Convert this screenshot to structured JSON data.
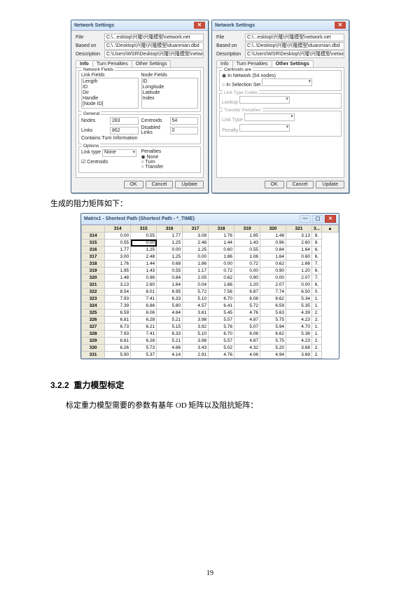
{
  "page_number": "19",
  "dlg1": {
    "title": "Network Settings",
    "kv": [
      {
        "lbl": "File",
        "val": "C:\\...esktop\\兴隆\\兴隆模型\\network.net"
      },
      {
        "lbl": "Based on",
        "val": "C:\\..\\Desktop\\兴隆\\兴隆模型\\duanmian.dbd"
      },
      {
        "lbl": "Description",
        "val": "C:\\Users\\WSR\\Desktop\\兴隆\\兴隆模型\\network.net"
      }
    ],
    "tabs": {
      "t1": "Info",
      "t2": "Turn Penalties",
      "t3": "Other Settings"
    },
    "legend_fields": "Network Fields",
    "link_hdr": "Link Fields",
    "node_hdr": "Node Fields",
    "link_items": [
      "Length",
      "ID",
      "Dir",
      "Handle",
      "[Node ID]"
    ],
    "node_items": [
      "ID",
      "Longitude",
      "Latitude",
      "Index"
    ],
    "legend_general": "General",
    "gen": {
      "nodes_l": "Nodes",
      "nodes_v": "283",
      "cent_l": "Centroids",
      "cent_v": "54",
      "links_l": "Links",
      "links_v": "862",
      "dis_l": "Disabled Links",
      "dis_v": "0",
      "cti": "Contains Turn Information"
    },
    "legend_options": "Options",
    "opt": {
      "lt": "Link type",
      "lt_v": "None",
      "pen": "Penalties",
      "p1": "None",
      "p2": "Turn",
      "p3": "Transfer",
      "cent": "Centroids"
    },
    "btn": {
      "ok": "OK",
      "cancel": "Cancel",
      "update": "Update"
    }
  },
  "dlg2": {
    "title": "Network Settings",
    "kv": [
      {
        "lbl": "File",
        "val": "C:\\...esktop\\兴隆\\兴隆模型\\network.net"
      },
      {
        "lbl": "Based on",
        "val": "C:\\..\\Desktop\\兴隆\\兴隆模型\\duanmian.dbd"
      },
      {
        "lbl": "Description",
        "val": "C:\\Users\\WSR\\Desktop\\兴隆\\兴隆模型\\network.net"
      }
    ],
    "tabs": {
      "t1": "Info",
      "t2": "Turn Penalties",
      "t3": "Other Settings"
    },
    "legend_centroids": "Centroids are",
    "cent": {
      "r1": "In Network (54 nodes)",
      "r2": "In Selection Set"
    },
    "legend_ltc": "Link Type Codes",
    "ltc_l": "Lookup",
    "legend_tp": "Transfer Penalties",
    "tp_l1": "Link Type",
    "tp_l2": "Penalty",
    "btn": {
      "ok": "OK",
      "cancel": "Cancel",
      "update": "Update"
    }
  },
  "text_after_screens": "生成的阻力矩阵如下：",
  "section_number": "3.2.2",
  "section_title": "重力模型标定",
  "paragraph": "标定重力模型需要的参数有基年 OD 矩阵以及阻抗矩阵：",
  "matrix_title": "Matrix1 - Shortest Path (Shortest Path - *_TIME)",
  "chart_data": {
    "type": "table",
    "title": "Matrix1 - Shortest Path (Shortest Path - *_TIME)",
    "col_headers": [
      "314",
      "315",
      "316",
      "317",
      "318",
      "319",
      "320",
      "321",
      "3..."
    ],
    "tail_col": "▲",
    "rows": [
      {
        "h": "314",
        "v": [
          "0.00",
          "0.55",
          "1.77",
          "3.08",
          "1.76",
          "1.95",
          "1.48",
          "3.13"
        ],
        "t": "8."
      },
      {
        "h": "315",
        "v": [
          "0.55",
          "0.00",
          "1.25",
          "2.48",
          "1.44",
          "1.43",
          "0.96",
          "2.60"
        ],
        "t": "8."
      },
      {
        "h": "316",
        "v": [
          "1.77",
          "1.25",
          "0.00",
          "1.25",
          "0.60",
          "0.55",
          "0.84",
          "1.64"
        ],
        "t": "6."
      },
      {
        "h": "317",
        "v": [
          "3.00",
          "2.48",
          "1.25",
          "0.00",
          "1.86",
          "1.06",
          "1.64",
          "0.60"
        ],
        "t": "6."
      },
      {
        "h": "318",
        "v": [
          "1.76",
          "1.44",
          "0.68",
          "1.86",
          "0.00",
          "0.72",
          "0.62",
          "1.66"
        ],
        "t": "7."
      },
      {
        "h": "319",
        "v": [
          "1.95",
          "1.43",
          "0.55",
          "1.17",
          "0.72",
          "0.00",
          "0.90",
          "1.20"
        ],
        "t": "6."
      },
      {
        "h": "320",
        "v": [
          "1.48",
          "0.96",
          "0.84",
          "2.05",
          "0.62",
          "0.90",
          "0.00",
          "2.07"
        ],
        "t": "7."
      },
      {
        "h": "321",
        "v": [
          "3.13",
          "2.60",
          "1.64",
          "0.04",
          "1.66",
          "1.20",
          "2.07",
          "0.00"
        ],
        "t": "6."
      },
      {
        "h": "322",
        "v": [
          "8.54",
          "8.01",
          "6.95",
          "5.72",
          "7.56",
          "6.87",
          "7.74",
          "6.50"
        ],
        "t": "0."
      },
      {
        "h": "323",
        "v": [
          "7.93",
          "7.41",
          "6.33",
          "5.10",
          "6.70",
          "6.08",
          "6.62",
          "5.34"
        ],
        "t": "1."
      },
      {
        "h": "324",
        "v": [
          "7.39",
          "6.86",
          "5.80",
          "4.57",
          "6.41",
          "5.72",
          "6.59",
          "5.35"
        ],
        "t": "1."
      },
      {
        "h": "325",
        "v": [
          "6.59",
          "6.06",
          "4.84",
          "3.61",
          "5.45",
          "4.76",
          "5.63",
          "4.39"
        ],
        "t": "2."
      },
      {
        "h": "326",
        "v": [
          "6.81",
          "6.28",
          "5.21",
          "3.98",
          "5.57",
          "4.87",
          "5.75",
          "4.23"
        ],
        "t": "2."
      },
      {
        "h": "327",
        "v": [
          "6.73",
          "6.21",
          "5.15",
          "3.92",
          "5.76",
          "5.07",
          "5.94",
          "4.70"
        ],
        "t": "1."
      },
      {
        "h": "328",
        "v": [
          "7.93",
          "7.41",
          "6.33",
          "5.10",
          "6.70",
          "6.08",
          "6.62",
          "5.36"
        ],
        "t": "1."
      },
      {
        "h": "329",
        "v": [
          "6.81",
          "6.28",
          "5.21",
          "3.98",
          "5.57",
          "4.87",
          "5.75",
          "4.23"
        ],
        "t": "2."
      },
      {
        "h": "330",
        "v": [
          "6.26",
          "5.73",
          "4.66",
          "3.43",
          "5.02",
          "4.32",
          "5.20",
          "3.68"
        ],
        "t": "2."
      },
      {
        "h": "331",
        "v": [
          "5.90",
          "5.37",
          "4.14",
          "2.91",
          "4.76",
          "4.06",
          "4.94",
          "3.69"
        ],
        "t": "2."
      }
    ]
  }
}
